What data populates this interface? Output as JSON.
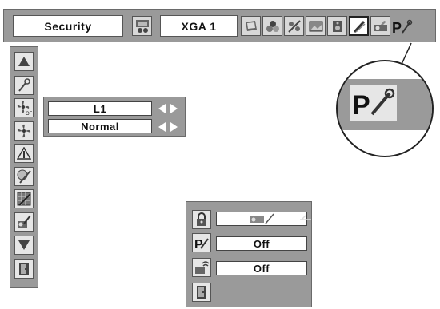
{
  "top_menu": {
    "menu_label": "Security",
    "input_label": "XGA 1",
    "icons": [
      "image-adjust-icon",
      "computer-system-icon",
      "color-icon",
      "screen-icon",
      "picture-icon",
      "sound-icon",
      "setting-icon",
      "projector-icon",
      "security-icon"
    ],
    "selected_icon": "setting-icon"
  },
  "left_menu": {
    "icons": [
      "up-arrow-icon",
      "key-icon",
      "fan-off-icon",
      "fan-icon",
      "warning-icon",
      "filter-icon",
      "grid-icon",
      "test-icon",
      "down-arrow-icon",
      "exit-icon"
    ]
  },
  "mid_submenu": {
    "field1_value": "L1",
    "field2_value": "Normal"
  },
  "magnifier": {
    "icon": "security-icon"
  },
  "security_submenu": {
    "lock_row_icon": "lock-icon",
    "lock_value_icon": "projector-lock-icon",
    "pin_value": "Off",
    "remote_value": "Off",
    "exit_icon": "exit-icon"
  },
  "colors": {
    "menu_bg": "#9a9a9a",
    "icon_bg": "#e6e6e6",
    "field_bg": "#ffffff"
  }
}
